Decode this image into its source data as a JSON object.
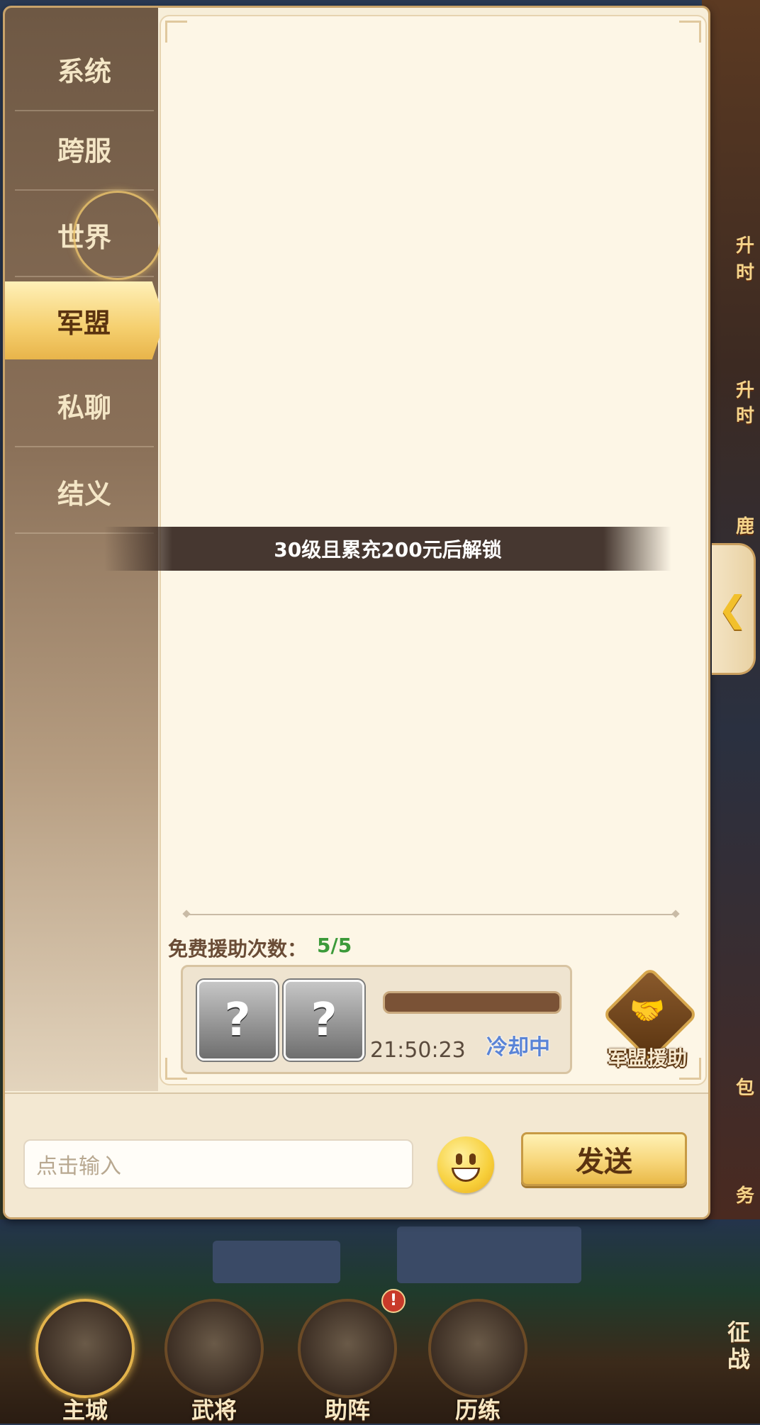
{
  "sidebar": {
    "tabs": [
      {
        "label": "系统",
        "active": false
      },
      {
        "label": "跨服",
        "active": false
      },
      {
        "label": "世界",
        "active": false
      },
      {
        "label": "军盟",
        "active": true
      },
      {
        "label": "私聊",
        "active": false
      },
      {
        "label": "结义",
        "active": false
      }
    ]
  },
  "chat": {
    "lock_message": "30级且累充200元后解锁"
  },
  "aid": {
    "free_label": "免费援助次数：",
    "free_count": "5/5",
    "slot1": "?",
    "slot2": "?",
    "timer": "21:50:23",
    "status": "冷却中",
    "button_label": "军盟援助"
  },
  "input": {
    "placeholder": "点击输入",
    "send_label": "发送"
  },
  "background": {
    "side_labels": [
      "升",
      "时",
      "升",
      "时",
      "鹿",
      "包",
      "务"
    ],
    "nav": [
      {
        "label": "主城",
        "active": true
      },
      {
        "label": "武将",
        "active": false
      },
      {
        "label": "助阵",
        "active": false,
        "badge": "!"
      },
      {
        "label": "历练",
        "active": false
      }
    ],
    "campaign_label": "征战"
  },
  "icons": {
    "emoji": "smiley-face-icon",
    "aid": "handshake-icon",
    "collapse": "chevron-left-icon"
  },
  "colors": {
    "active_tab": "#f5cf6e",
    "free_count": "#3c9a3a",
    "cooldown": "#5a84d6"
  }
}
